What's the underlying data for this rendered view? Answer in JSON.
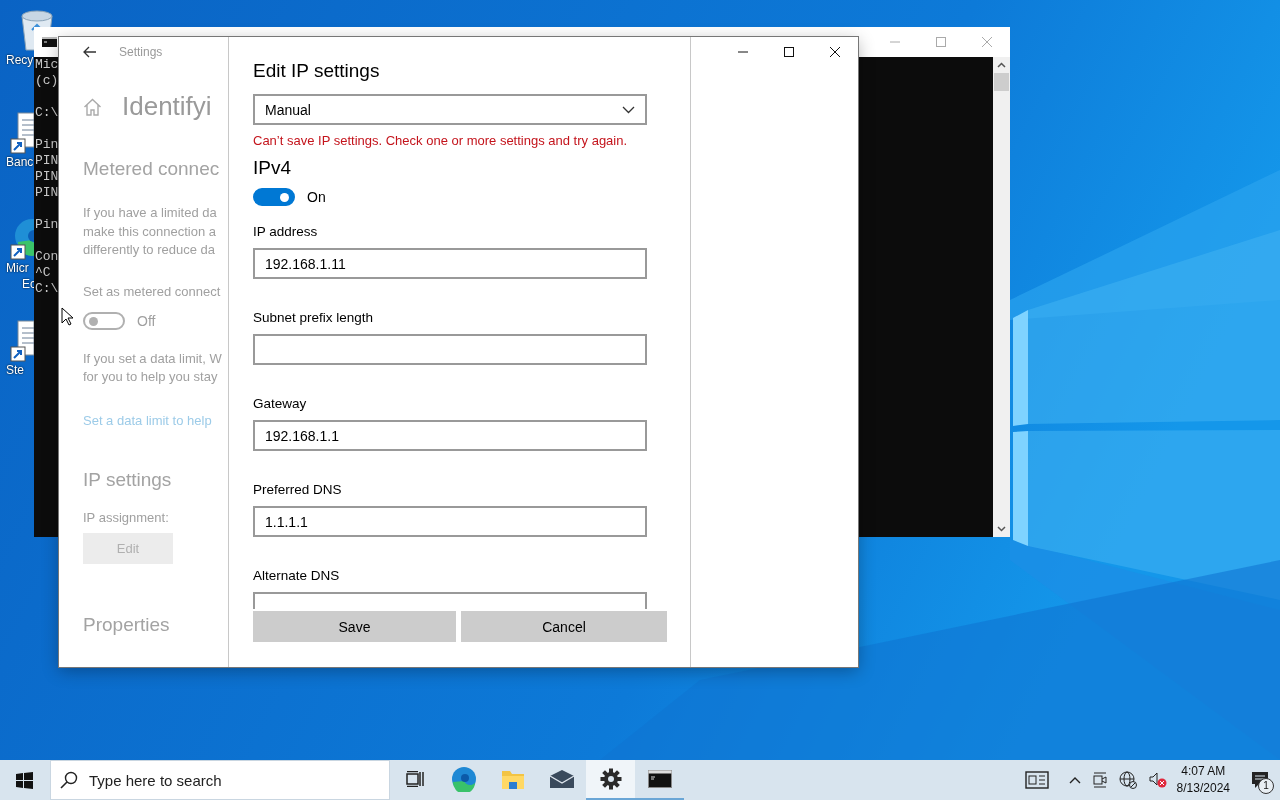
{
  "desktop": {
    "icons": [
      {
        "kind": "recycle-bin",
        "lines": [
          "Recy"
        ]
      },
      {
        "kind": "shortcut",
        "lines": [
          "Banc"
        ]
      },
      {
        "kind": "browser-shortcut",
        "lines": [
          "Micr",
          "Ec"
        ]
      },
      {
        "kind": "shortcut",
        "lines": [
          "Ste"
        ]
      }
    ]
  },
  "console": {
    "blocks": [
      [
        "Mic",
        "(c)"
      ],
      [
        "C:\\"
      ],
      [
        "Pin",
        "PIN",
        "PIN",
        "PIN"
      ],
      [
        "Pin"
      ],
      [
        "Con",
        "^C",
        "C:\\"
      ]
    ]
  },
  "settings": {
    "title": "Settings",
    "heading": "Identifyi",
    "metered": {
      "heading": "Metered connec",
      "text": [
        "If you have a limited da",
        "make this connection a",
        "differently to reduce da"
      ],
      "label": "Set as metered connect",
      "toggle": {
        "on": false,
        "label": "Off"
      },
      "limit_text": [
        "If you set a data limit, W",
        "for you to help you stay"
      ],
      "link": "Set a data limit to help"
    },
    "ip": {
      "heading": "IP settings",
      "label": "IP assignment:",
      "button": "Edit"
    },
    "properties_heading": "Properties"
  },
  "dialog": {
    "title": "Edit IP settings",
    "mode": {
      "value": "Manual"
    },
    "error": "Can’t save IP settings. Check one or more settings and try again.",
    "section": "IPv4",
    "toggle": {
      "on": true,
      "label": "On"
    },
    "fields": [
      {
        "label": "IP address",
        "value": "192.168.1.11"
      },
      {
        "label": "Subnet prefix length"
      },
      {
        "label": "Gateway",
        "value": "192.168.1.1"
      },
      {
        "label": "Preferred DNS",
        "value": "1.1.1.1"
      },
      {
        "label": "Alternate DNS"
      }
    ],
    "buttons": [
      "Save",
      "Cancel"
    ]
  },
  "taskbar": {
    "search": {
      "placeholder": "Type here to search"
    },
    "apps": [
      {
        "kind": "task-view",
        "open": false,
        "selected": false
      },
      {
        "kind": "browser",
        "open": false,
        "selected": false
      },
      {
        "kind": "folder",
        "open": false,
        "selected": false
      },
      {
        "kind": "mail",
        "open": false,
        "selected": false
      },
      {
        "kind": "settings",
        "open": true,
        "selected": true
      },
      {
        "kind": "terminal",
        "open": true,
        "selected": false
      }
    ],
    "clock": {
      "time": "4:07 AM",
      "date": "8/13/2024"
    },
    "notifications": {
      "count": "1"
    }
  }
}
